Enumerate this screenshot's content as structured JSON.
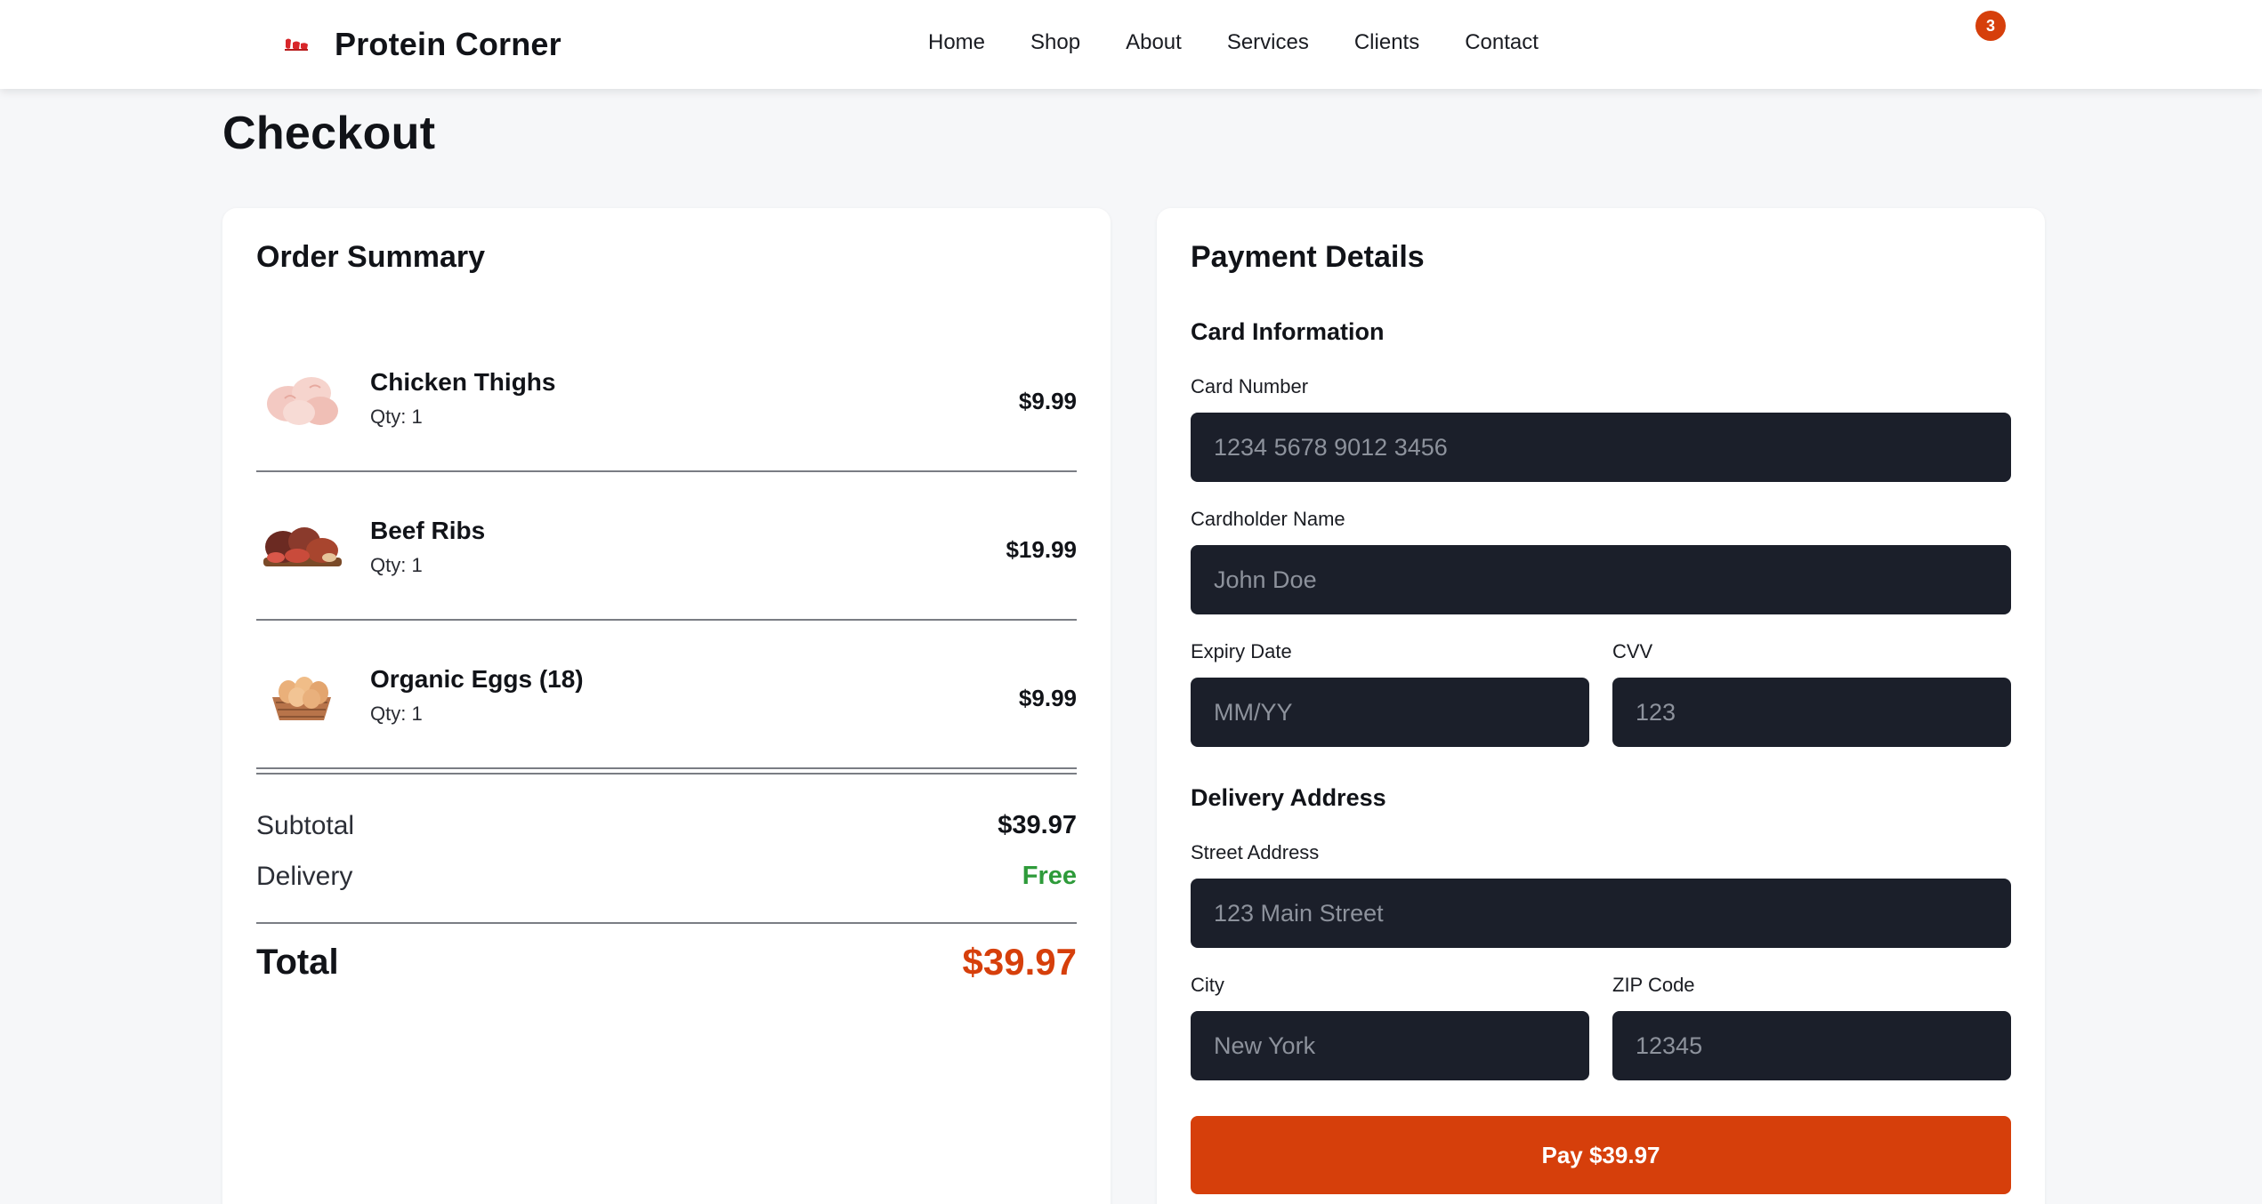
{
  "header": {
    "brand": "Protein Corner",
    "nav": [
      "Home",
      "Shop",
      "About",
      "Services",
      "Clients",
      "Contact"
    ],
    "cart_count": "3",
    "accent_color": "#d63f0b"
  },
  "page_title": "Checkout",
  "order_summary": {
    "title": "Order Summary",
    "items": [
      {
        "name": "Chicken Thighs",
        "qty": "Qty: 1",
        "price": "$9.99",
        "image": "chicken-thighs-image"
      },
      {
        "name": "Beef Ribs",
        "qty": "Qty: 1",
        "price": "$19.99",
        "image": "beef-ribs-image"
      },
      {
        "name": "Organic Eggs (18)",
        "qty": "Qty: 1",
        "price": "$9.99",
        "image": "organic-eggs-image"
      }
    ],
    "subtotal_label": "Subtotal",
    "subtotal_value": "$39.97",
    "delivery_label": "Delivery",
    "delivery_value": "Free",
    "total_label": "Total",
    "total_value": "$39.97"
  },
  "payment": {
    "title": "Payment Details",
    "card_section": "Card Information",
    "card_number_label": "Card Number",
    "card_number_placeholder": "1234 5678 9012 3456",
    "cardholder_label": "Cardholder Name",
    "cardholder_placeholder": "John Doe",
    "expiry_label": "Expiry Date",
    "expiry_placeholder": "MM/YY",
    "cvv_label": "CVV",
    "cvv_placeholder": "123",
    "address_section": "Delivery Address",
    "street_label": "Street Address",
    "street_placeholder": "123 Main Street",
    "city_label": "City",
    "city_placeholder": "New York",
    "zip_label": "ZIP Code",
    "zip_placeholder": "12345",
    "pay_button": "Pay $39.97"
  }
}
